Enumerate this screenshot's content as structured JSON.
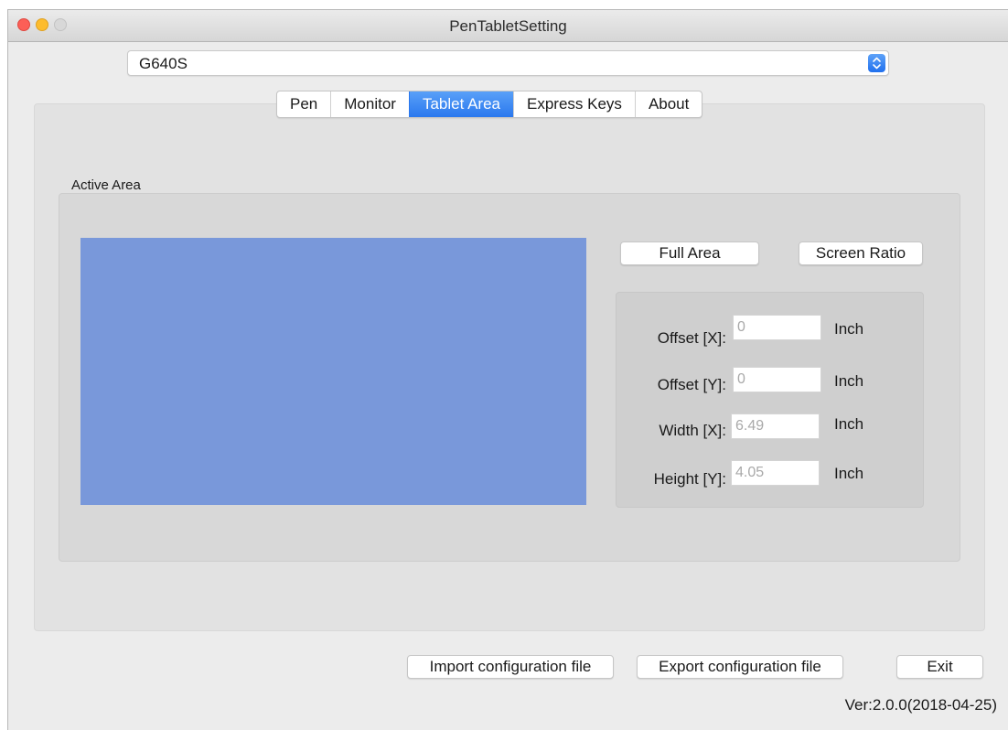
{
  "window": {
    "title": "PenTabletSetting"
  },
  "device_select": {
    "selected": "G640S"
  },
  "tabs": [
    {
      "label": "Pen",
      "active": false
    },
    {
      "label": "Monitor",
      "active": false
    },
    {
      "label": "Tablet Area",
      "active": true
    },
    {
      "label": "Express Keys",
      "active": false
    },
    {
      "label": "About",
      "active": false
    }
  ],
  "active_area": {
    "group_title": "Active Area",
    "full_area_label": "Full Area",
    "screen_ratio_label": "Screen Ratio",
    "fields": [
      {
        "label": "Offset [X]:",
        "value": "0",
        "unit": "Inch"
      },
      {
        "label": "Offset [Y]:",
        "value": "0",
        "unit": "Inch"
      },
      {
        "label": "Width [X]:",
        "value": "6.49",
        "unit": "Inch"
      },
      {
        "label": "Height [Y]:",
        "value": "4.05",
        "unit": "Inch"
      }
    ]
  },
  "footer": {
    "import_label": "Import configuration file",
    "export_label": "Export configuration file",
    "exit_label": "Exit",
    "version": "Ver:2.0.0(2018-04-25)"
  },
  "colors": {
    "accent": "#2a78ee",
    "area_preview": "#7998da",
    "close": "#fc5f57",
    "minimize": "#fdbc2e"
  },
  "icons": {
    "select_stepper": "updown-chevron-icon"
  }
}
